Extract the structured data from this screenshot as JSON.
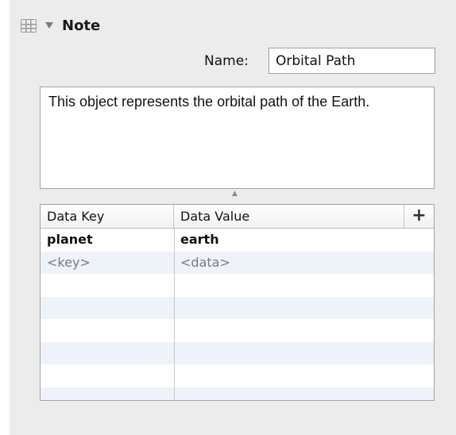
{
  "inspector": {
    "section_title": "Note",
    "section_icon": "table-grid-icon",
    "disclosure_icon": "disclosure-triangle-down-icon"
  },
  "name_field": {
    "label": "Name:",
    "value": "Orbital Path"
  },
  "note": {
    "text": "This object represents the orbital path of the Earth."
  },
  "data_table": {
    "headers": {
      "key": "Data Key",
      "value": "Data Value",
      "add": "+"
    },
    "rows": [
      {
        "key": "planet",
        "value": "earth"
      },
      {
        "key": "<key>",
        "value": "<data>"
      }
    ],
    "empty_row_count": 6
  },
  "colors": {
    "panel_background": "#ececec",
    "alternate_row": "#eef3fa",
    "placeholder_text": "#7a7a7a"
  }
}
